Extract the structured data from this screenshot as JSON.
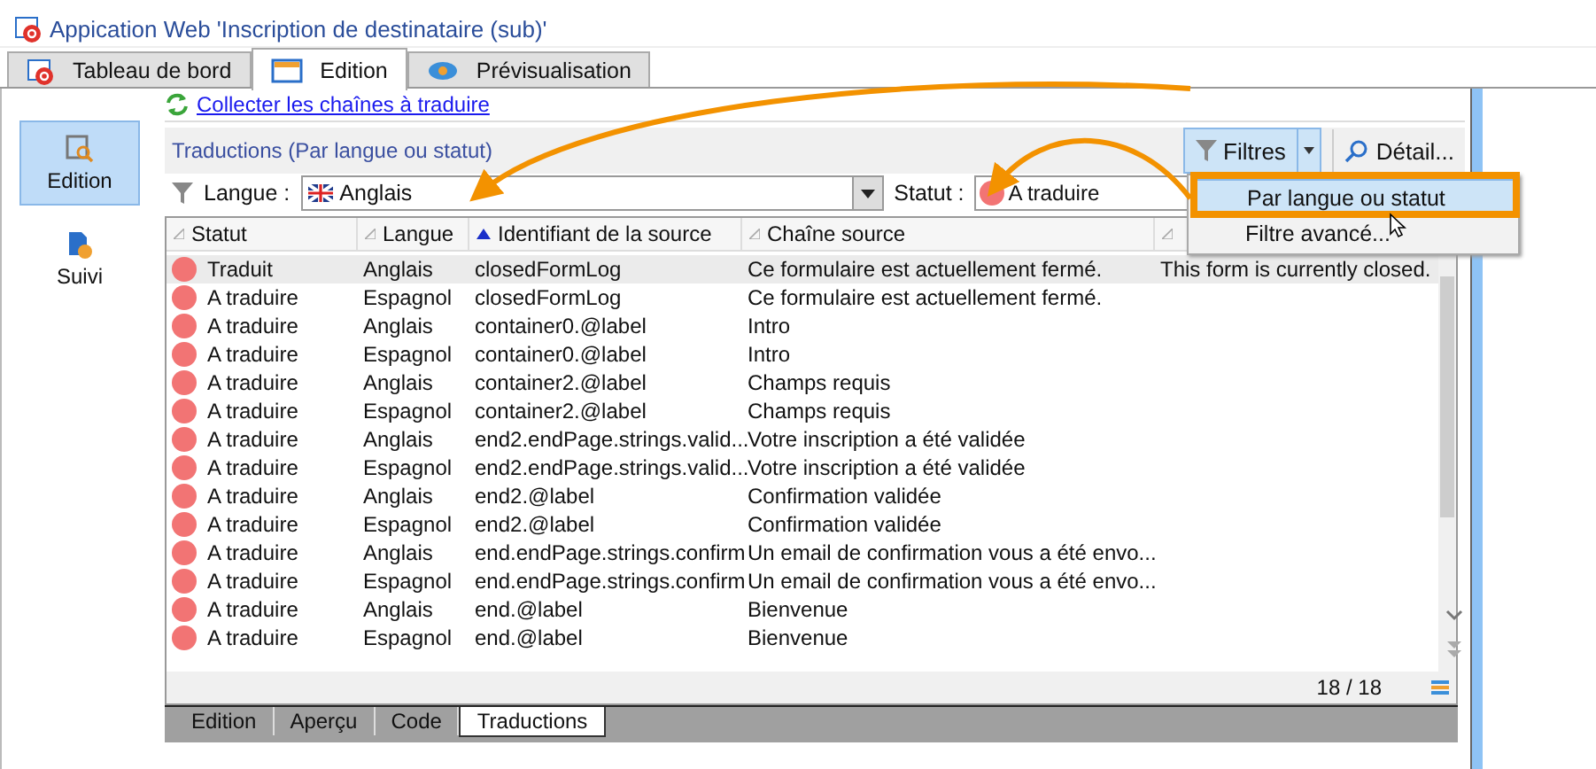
{
  "window": {
    "title": "Appication Web 'Inscription de destinataire (sub)'"
  },
  "tabs": [
    {
      "label": "Tableau de bord",
      "selected": false
    },
    {
      "label": "Edition",
      "selected": true
    },
    {
      "label": "Prévisualisation",
      "selected": false
    }
  ],
  "sidebar": {
    "items": [
      {
        "label": "Edition",
        "selected": true
      },
      {
        "label": "Suivi",
        "selected": false
      }
    ]
  },
  "link": "Collecter les chaînes à traduire",
  "panel": {
    "title": "Traductions (Par langue ou statut)",
    "filter_button": "Filtres",
    "detail_button": "Détail..."
  },
  "filters": {
    "language_label": "Langue :",
    "language_value": "Anglais",
    "status_label": "Statut :",
    "status_value": "A traduire"
  },
  "menu": {
    "items": [
      {
        "label": "Par langue ou statut",
        "selected": true
      },
      {
        "label": "Filtre avancé...",
        "selected": false
      }
    ]
  },
  "table": {
    "columns": [
      {
        "label": "Statut",
        "sorted": false
      },
      {
        "label": "Langue",
        "sorted": false
      },
      {
        "label": "Identifiant de la source",
        "sorted": true
      },
      {
        "label": "Chaîne source",
        "sorted": false
      },
      {
        "sorted": false
      }
    ],
    "rows": [
      {
        "selected": true,
        "cells": [
          "Traduit",
          "Anglais",
          "closedFormLog",
          "Ce formulaire est actuellement fermé.",
          "This form is currently closed."
        ]
      },
      {
        "selected": false,
        "cells": [
          "A traduire",
          "Espagnol",
          "closedFormLog",
          "Ce formulaire est actuellement fermé.",
          ""
        ]
      },
      {
        "selected": false,
        "cells": [
          "A traduire",
          "Anglais",
          "container0.@label",
          "Intro",
          ""
        ]
      },
      {
        "selected": false,
        "cells": [
          "A traduire",
          "Espagnol",
          "container0.@label",
          "Intro",
          ""
        ]
      },
      {
        "selected": false,
        "cells": [
          "A traduire",
          "Anglais",
          "container2.@label",
          "Champs requis",
          ""
        ]
      },
      {
        "selected": false,
        "cells": [
          "A traduire",
          "Espagnol",
          "container2.@label",
          "Champs requis",
          ""
        ]
      },
      {
        "selected": false,
        "cells": [
          "A traduire",
          "Anglais",
          "end2.endPage.strings.valid...",
          "Votre inscription a été validée",
          ""
        ]
      },
      {
        "selected": false,
        "cells": [
          "A traduire",
          "Espagnol",
          "end2.endPage.strings.valid...",
          "Votre inscription a été validée",
          ""
        ]
      },
      {
        "selected": false,
        "cells": [
          "A traduire",
          "Anglais",
          "end2.@label",
          "Confirmation validée",
          ""
        ]
      },
      {
        "selected": false,
        "cells": [
          "A traduire",
          "Espagnol",
          "end2.@label",
          "Confirmation validée",
          ""
        ]
      },
      {
        "selected": false,
        "cells": [
          "A traduire",
          "Anglais",
          "end.endPage.strings.confirm",
          "Un email de confirmation vous a été envo...",
          ""
        ]
      },
      {
        "selected": false,
        "cells": [
          "A traduire",
          "Espagnol",
          "end.endPage.strings.confirm",
          "Un email de confirmation vous a été envo...",
          ""
        ]
      },
      {
        "selected": false,
        "cells": [
          "A traduire",
          "Anglais",
          "end.@label",
          "Bienvenue",
          ""
        ]
      },
      {
        "selected": false,
        "cells": [
          "A traduire",
          "Espagnol",
          "end.@label",
          "Bienvenue",
          ""
        ]
      }
    ],
    "counter": "18 / 18"
  },
  "bottom_tabs": [
    {
      "label": "Edition",
      "selected": false
    },
    {
      "label": "Aperçu",
      "selected": false
    },
    {
      "label": "Code",
      "selected": false
    },
    {
      "label": "Traductions",
      "selected": true
    }
  ]
}
